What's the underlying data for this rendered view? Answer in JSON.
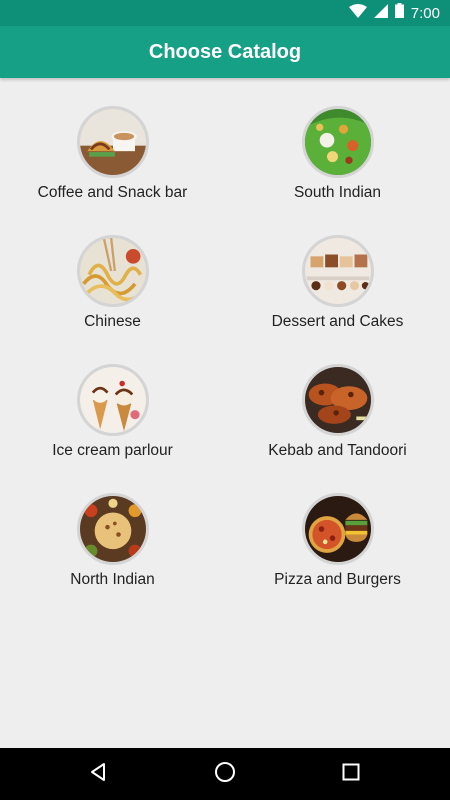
{
  "status_bar": {
    "time": "7:00",
    "icons": [
      "wifi-icon",
      "signal-icon",
      "battery-icon"
    ]
  },
  "app_bar": {
    "title": "Choose Catalog"
  },
  "catalogs": [
    {
      "label": "Coffee and Snack bar",
      "image": "coffee-snack-image"
    },
    {
      "label": "South Indian",
      "image": "south-indian-image"
    },
    {
      "label": "Chinese",
      "image": "chinese-image"
    },
    {
      "label": "Dessert and Cakes",
      "image": "dessert-cakes-image"
    },
    {
      "label": "Ice cream parlour",
      "image": "ice-cream-image"
    },
    {
      "label": "Kebab and Tandoori",
      "image": "kebab-tandoori-image"
    },
    {
      "label": "North Indian",
      "image": "north-indian-image"
    },
    {
      "label": "Pizza and Burgers",
      "image": "pizza-burgers-image"
    }
  ],
  "nav_bar": {
    "buttons": [
      "back-icon",
      "home-icon",
      "recents-icon"
    ]
  },
  "colors": {
    "status_bar": "#0e8f77",
    "app_bar": "#16a086",
    "background": "#eeeeee"
  }
}
